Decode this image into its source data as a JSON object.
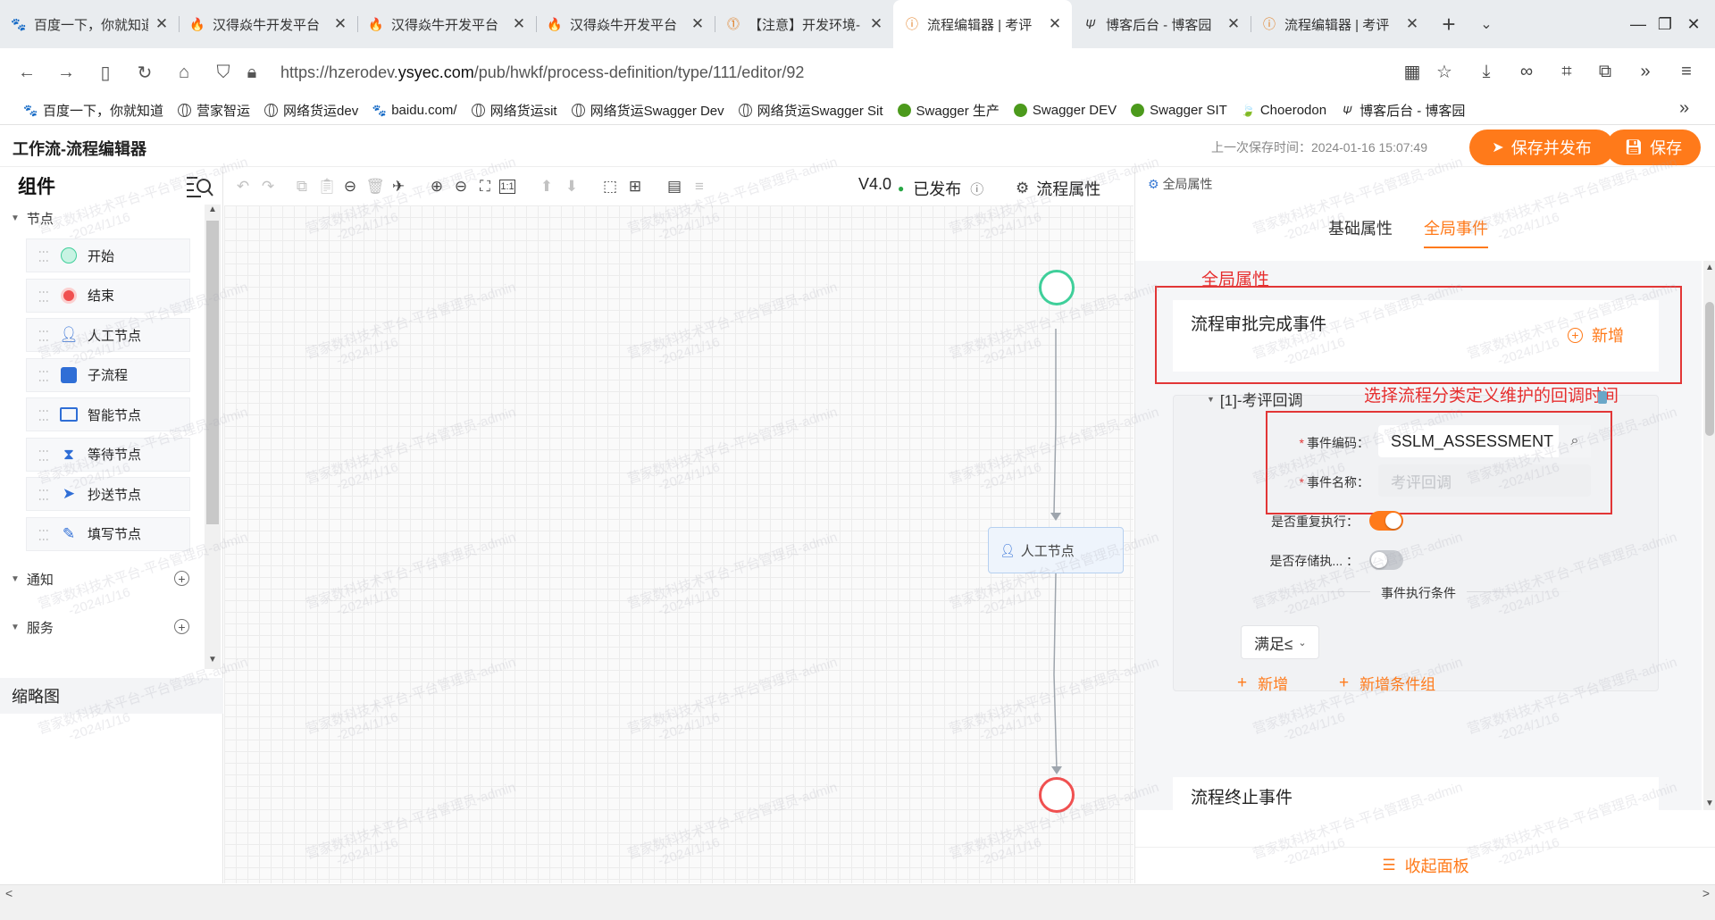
{
  "browser": {
    "tabs": [
      {
        "title": "百度一下，你就知道",
        "icon": "baidu-paw",
        "active": false
      },
      {
        "title": "汉得焱牛开发平台",
        "icon": "hand-flame",
        "active": false
      },
      {
        "title": "汉得焱牛开发平台",
        "icon": "hand-flame",
        "active": false
      },
      {
        "title": "汉得焱牛开发平台",
        "icon": "hand-flame",
        "active": false
      },
      {
        "title": "【注意】开发环境-",
        "icon": "warning-circle",
        "active": false
      },
      {
        "title": "流程编辑器 | 考评",
        "icon": "warning-circle",
        "active": true
      },
      {
        "title": "博客后台 - 博客园",
        "icon": "cnblogs",
        "active": false
      },
      {
        "title": "流程编辑器 | 考评",
        "icon": "warning-circle",
        "active": false
      }
    ],
    "new_tab": "+",
    "url_prefix": "https://hzerodev.",
    "url_host": "ysyec.com",
    "url_path": "/pub/hwkf/process-definition/type/111/editor/92",
    "bookmarks": [
      {
        "label": "百度一下，你就知道",
        "icon": "baidu-paw"
      },
      {
        "label": "营家智运",
        "icon": "globe"
      },
      {
        "label": "网络货运dev",
        "icon": "globe"
      },
      {
        "label": "baidu.com/",
        "icon": "baidu-paw"
      },
      {
        "label": "网络货运sit",
        "icon": "globe"
      },
      {
        "label": "网络货运Swagger Dev",
        "icon": "globe"
      },
      {
        "label": "网络货运Swagger Sit",
        "icon": "globe"
      },
      {
        "label": "Swagger 生产",
        "icon": "swagger"
      },
      {
        "label": "Swagger DEV",
        "icon": "swagger"
      },
      {
        "label": "Swagger SIT",
        "icon": "swagger"
      },
      {
        "label": "Choerodon",
        "icon": "leaf"
      },
      {
        "label": "博客后台 - 博客园",
        "icon": "cnblogs"
      }
    ]
  },
  "app": {
    "title": "工作流-流程编辑器",
    "last_saved": "上一次保存时间：2024-01-16 15:07:49",
    "save_publish_label": "保存并发布",
    "save_label": "保存",
    "accent_color": "#ff7a1a"
  },
  "left_panel": {
    "title": "组件",
    "sections": {
      "nodes": "节点",
      "notify": "通知",
      "service": "服务"
    },
    "nodes": [
      {
        "label": "开始",
        "icon": "start-circle-icon"
      },
      {
        "label": "结束",
        "icon": "end-circle-icon"
      },
      {
        "label": "人工节点",
        "icon": "user-icon"
      },
      {
        "label": "子流程",
        "icon": "subprocess-icon"
      },
      {
        "label": "智能节点",
        "icon": "smart-node-icon"
      },
      {
        "label": "等待节点",
        "icon": "hourglass-icon"
      },
      {
        "label": "抄送节点",
        "icon": "send-icon"
      },
      {
        "label": "填写节点",
        "icon": "edit-icon"
      }
    ],
    "minimap_title": "缩略图"
  },
  "toolbar": {
    "version": "V4.0",
    "status": "已发布",
    "status_color": "#28a745",
    "process_props": "流程属性"
  },
  "canvas": {
    "task_node_label": "人工节点",
    "watermark_line1": "营家数科技术平台-平台管理员-admin",
    "watermark_line2": "-2024/1/16"
  },
  "right_panel": {
    "header": "全局属性",
    "tabs": [
      "基础属性",
      "全局事件"
    ],
    "active_tab": "全局事件",
    "annotation_global": "全局属性",
    "annotation_callback": "选择流程分类定义维护的回调时间",
    "approval_event_title": "流程审批完成事件",
    "add_label": "新增",
    "event_group_title": "[1]-考评回调",
    "event_code_label": "事件编码：",
    "event_code_value": "SSLM_ASSESSMENT",
    "event_name_label": "事件名称：",
    "event_name_placeholder": "考评回调",
    "repeat_label": "是否重复执行：",
    "repeat_on": true,
    "store_label": "是否存储执... ：",
    "store_on": false,
    "condition_title": "事件执行条件",
    "condition_select": "满足≤",
    "add_condition": "新增",
    "add_condition_group": "新增条件组",
    "terminate_event_title": "流程终止事件",
    "collapse_label": "收起面板"
  }
}
